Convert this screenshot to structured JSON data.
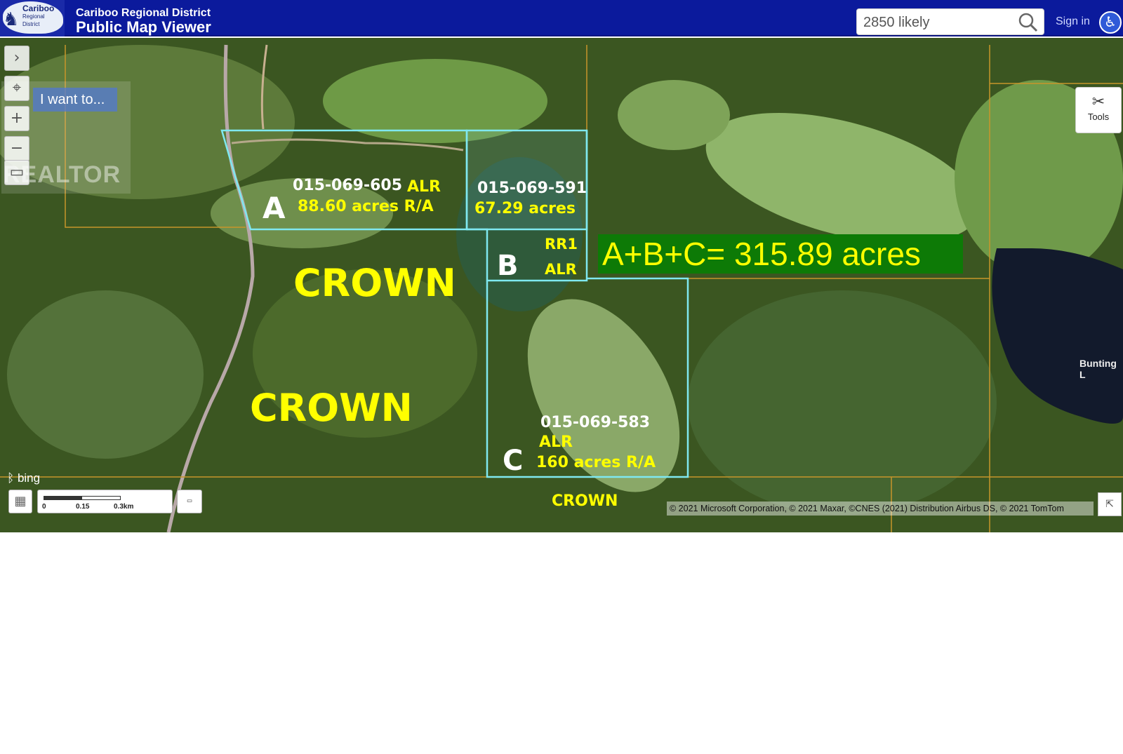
{
  "header": {
    "logo_title": "Cariboo",
    "logo_sub1": "Regional",
    "logo_sub2": "District",
    "title_line1": "Cariboo Regional District",
    "title_line2": "Public Map Viewer",
    "search_value": "2850 likely",
    "sign_in": "Sign in"
  },
  "toolbar": {
    "i_want_to": "I want to...",
    "tools_label": "Tools",
    "watermark": "REALTOR"
  },
  "parcels": {
    "a": {
      "letter": "A",
      "pid": "015-069-605",
      "zone": "ALR",
      "area": "88.60 acres R/A"
    },
    "b": {
      "letter": "B",
      "pid": "015-069-591",
      "area": "67.29 acres",
      "zone1": "RR1",
      "zone2": "ALR"
    },
    "c": {
      "letter": "C",
      "pid": "015-069-583",
      "zone": "ALR",
      "area": "160 acres R/A"
    }
  },
  "crown_labels": [
    "CROWN",
    "CROWN",
    "CROWN"
  ],
  "total": "A+B+C= 315.89 acres",
  "map_labels": {
    "lake": "Bunting L"
  },
  "scale": {
    "t0": "0",
    "t1": "0.15",
    "t2": "0.3km"
  },
  "attribution": {
    "provider": "bing",
    "copyright": "© 2021 Microsoft Corporation, © 2021 Maxar, ©CNES (2021) Distribution Airbus DS, © 2021 TomTom"
  },
  "colors": {
    "header": "#0b1a9c",
    "parcel_outline": "#7fe8f0",
    "label_yellow": "#ffff00",
    "total_box": "#0d7a06"
  }
}
